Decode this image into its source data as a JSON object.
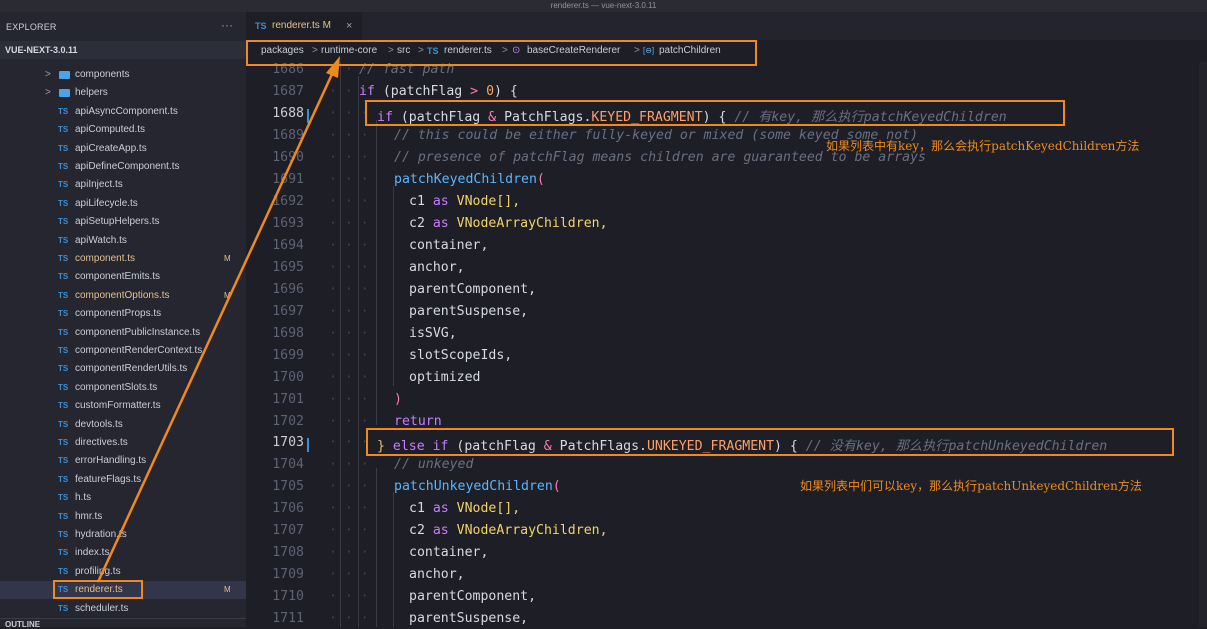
{
  "window_title": "renderer.ts — vue-next-3.0.11",
  "explorer": {
    "title": "EXPLORER",
    "more": "···",
    "project": "VUE-NEXT-3.0.11",
    "folders": [
      "components",
      "helpers"
    ],
    "files": [
      {
        "name": "apiAsyncComponent.ts",
        "modified": false
      },
      {
        "name": "apiComputed.ts",
        "modified": false
      },
      {
        "name": "apiCreateApp.ts",
        "modified": false
      },
      {
        "name": "apiDefineComponent.ts",
        "modified": false
      },
      {
        "name": "apiInject.ts",
        "modified": false
      },
      {
        "name": "apiLifecycle.ts",
        "modified": false
      },
      {
        "name": "apiSetupHelpers.ts",
        "modified": false
      },
      {
        "name": "apiWatch.ts",
        "modified": false
      },
      {
        "name": "component.ts",
        "modified": true
      },
      {
        "name": "componentEmits.ts",
        "modified": false
      },
      {
        "name": "componentOptions.ts",
        "modified": true
      },
      {
        "name": "componentProps.ts",
        "modified": false
      },
      {
        "name": "componentPublicInstance.ts",
        "modified": false
      },
      {
        "name": "componentRenderContext.ts",
        "modified": false
      },
      {
        "name": "componentRenderUtils.ts",
        "modified": false
      },
      {
        "name": "componentSlots.ts",
        "modified": false
      },
      {
        "name": "customFormatter.ts",
        "modified": false
      },
      {
        "name": "devtools.ts",
        "modified": false
      },
      {
        "name": "directives.ts",
        "modified": false
      },
      {
        "name": "errorHandling.ts",
        "modified": false
      },
      {
        "name": "featureFlags.ts",
        "modified": false
      },
      {
        "name": "h.ts",
        "modified": false
      },
      {
        "name": "hmr.ts",
        "modified": false
      },
      {
        "name": "hydration.ts",
        "modified": false
      },
      {
        "name": "index.ts",
        "modified": false
      },
      {
        "name": "profiling.ts",
        "modified": false
      },
      {
        "name": "renderer.ts",
        "modified": true,
        "selected": true
      },
      {
        "name": "scheduler.ts",
        "modified": false
      }
    ],
    "ts_label": "TS",
    "modified_badge": "M",
    "outline": "OUTLINE"
  },
  "tab": {
    "ts": "TS",
    "name": "renderer.ts",
    "badge": "M",
    "close": "×"
  },
  "breadcrumb": [
    "packages",
    ">",
    "runtime-core",
    ">",
    "src",
    ">",
    "TS",
    "renderer.ts",
    ">",
    "⊙",
    "baseCreateRenderer",
    ">",
    "[⊖]",
    "patchChildren"
  ],
  "annotations": {
    "keyed": "如果列表中有key，那么会执行patchKeyedChildren方法",
    "unkeyed": "如果列表中们可以key，那么执行patchUnkeyedChildren方法"
  },
  "code": {
    "line_numbers": [
      "1686",
      "1687",
      "1688",
      "1689",
      "1690",
      "1691",
      "1692",
      "1693",
      "1694",
      "1695",
      "1696",
      "1697",
      "1698",
      "1699",
      "1700",
      "1701",
      "1702",
      "1703",
      "1704",
      "1705",
      "1706",
      "1707",
      "1708",
      "1709",
      "1710",
      "1711"
    ],
    "l1686": "// fast path",
    "l1687_if": "if",
    "l1687_a": " (patchFlag ",
    "l1687_op": ">",
    "l1687_n": " 0",
    "l1687_b": ") {",
    "l1688_if": "if",
    "l1688_a": " (patchFlag ",
    "l1688_op": "&",
    "l1688_b": " PatchFlags.",
    "l1688_c": "KEYED_FRAGMENT",
    "l1688_d": ") {",
    "l1688_cm": " // 有key, 那么执行patchKeyedChildren",
    "l1689": "// this could be either fully-keyed or mixed (some keyed some not)",
    "l1690": "// presence of patchFlag means children are guaranteed to be arrays",
    "l1691": "patchKeyedChildren",
    "l1691_b": "(",
    "c1": "c1",
    "as": " as ",
    "vnodearr": "VNode[],",
    "c2": "c2",
    "vnac": "VNodeArrayChildren,",
    "container": "container,",
    "anchor": "anchor,",
    "parentComponent": "parentComponent,",
    "parentSuspense": "parentSuspense,",
    "isSVG": "isSVG,",
    "slotScopeIds": "slotScopeIds,",
    "optimized": "optimized",
    "close_paren": ")",
    "ret": "return",
    "l1703_a": "} ",
    "l1703_else": "else if",
    "l1703_b": " (patchFlag ",
    "l1703_op": "&",
    "l1703_c": " PatchFlags.",
    "l1703_d": "UNKEYED_FRAGMENT",
    "l1703_e": ") {",
    "l1703_cm": " // 没有key, 那么执行patchUnkeyedChildren",
    "l1704": "// unkeyed",
    "l1705": "patchUnkeyedChildren"
  },
  "colors": {
    "accent": "#f08a1c",
    "keyword": "#c77dff",
    "function": "#5ab4ff",
    "type": "#f2d36b"
  }
}
